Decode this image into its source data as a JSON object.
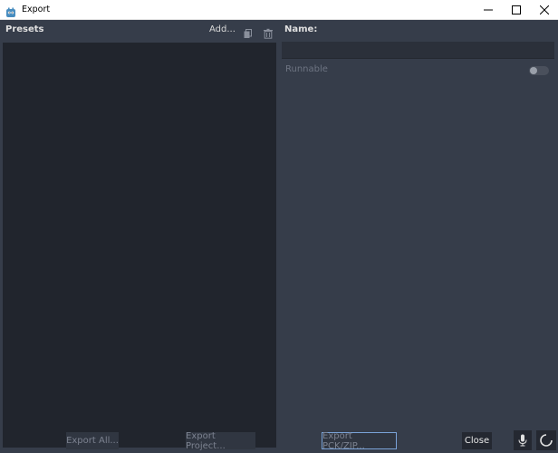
{
  "window": {
    "title": "Export",
    "icon": "godot-app-icon",
    "controls": [
      "minimize-icon",
      "maximize-icon",
      "close-icon"
    ]
  },
  "presets": {
    "label": "Presets",
    "add_label": "Add...",
    "duplicate_icon": "duplicate-icon",
    "delete_icon": "trash-icon",
    "items": []
  },
  "details": {
    "name_label": "Name:",
    "name_value": "",
    "runnable_label": "Runnable",
    "runnable_enabled": false
  },
  "footer": {
    "export_all_label": "Export All...",
    "export_project_label": "Export Project...",
    "export_pck_label": "Export PCK/ZIP...",
    "close_label": "Close",
    "mic_icon": "microphone-icon",
    "spinner_icon": "refresh-icon"
  },
  "colors": {
    "background": "#363d4a",
    "list_background": "#21252d",
    "focus_border": "#7aa3d8"
  }
}
